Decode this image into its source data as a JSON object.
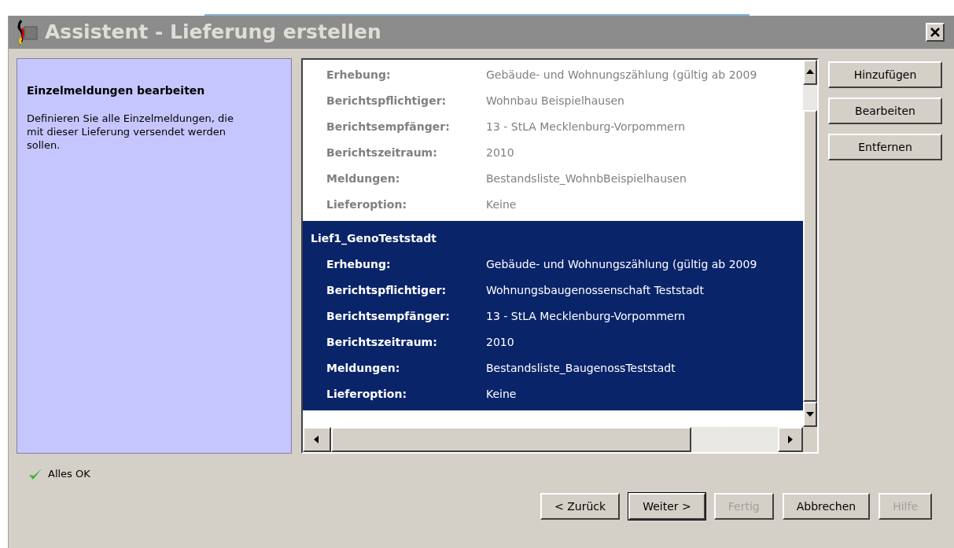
{
  "window": {
    "title": "Assistent - Lieferung erstellen"
  },
  "info_panel": {
    "heading": "Einzelmeldungen bearbeiten",
    "text": "Definieren Sie alle Einzelmeldungen, die mit dieser Lieferung versendet werden sollen."
  },
  "deliveries": [
    {
      "selected": false,
      "fields": [
        {
          "label": "Erhebung:",
          "value": "Gebäude- und Wohnungszählung (gültig ab 2009"
        },
        {
          "label": "Berichtspflichtiger:",
          "value": "Wohnbau Beispielhausen"
        },
        {
          "label": "Berichtsempfänger:",
          "value": "13 - StLA Mecklenburg-Vorpommern"
        },
        {
          "label": "Berichtszeitraum:",
          "value": "2010"
        },
        {
          "label": "Meldungen:",
          "value": "Bestandsliste_WohnbBeispielhausen"
        },
        {
          "label": "Lieferoption:",
          "value": "Keine"
        }
      ]
    },
    {
      "name": "Lief1_GenoTeststadt",
      "selected": true,
      "fields": [
        {
          "label": "Erhebung:",
          "value": "Gebäude- und Wohnungszählung (gültig ab 2009"
        },
        {
          "label": "Berichtspflichtiger:",
          "value": "Wohnungsbaugenossenschaft Teststadt"
        },
        {
          "label": "Berichtsempfänger:",
          "value": "13 - StLA Mecklenburg-Vorpommern"
        },
        {
          "label": "Berichtszeitraum:",
          "value": "2010"
        },
        {
          "label": "Meldungen:",
          "value": "Bestandsliste_BaugenossTeststadt"
        },
        {
          "label": "Lieferoption:",
          "value": "Keine"
        }
      ]
    }
  ],
  "side_buttons": [
    "Hinzufügen",
    "Bearbeiten",
    "Entfernen"
  ],
  "status": {
    "text": "Alles OK"
  },
  "nav_buttons": [
    {
      "label": "< Zurück",
      "disabled": false,
      "default": false
    },
    {
      "label": "Weiter >",
      "disabled": false,
      "default": true
    },
    {
      "label": "Fertig",
      "disabled": true,
      "default": false
    },
    {
      "label": "Abbrechen",
      "disabled": false,
      "default": false
    },
    {
      "label": "Hilfe",
      "disabled": true,
      "default": false
    }
  ]
}
